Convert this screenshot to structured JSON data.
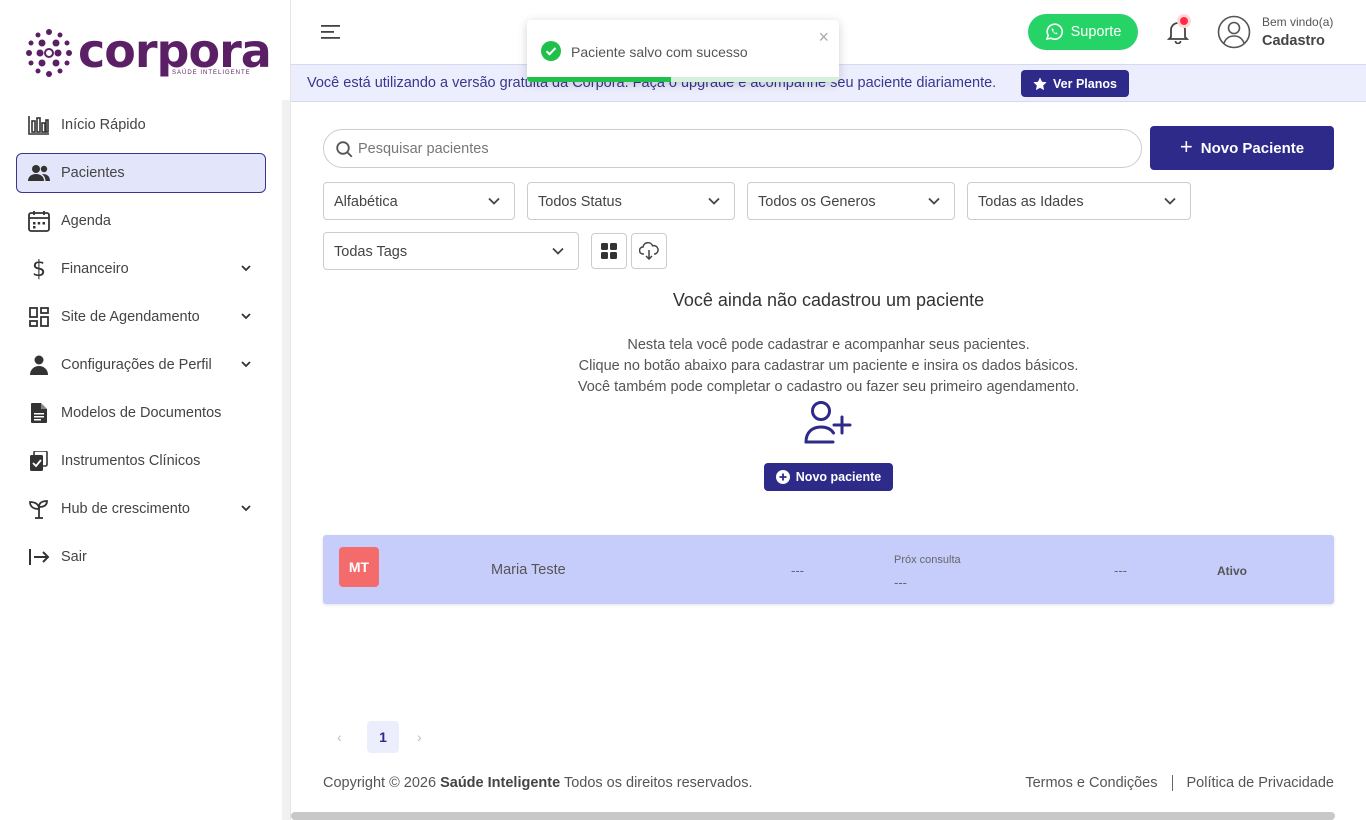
{
  "brand": {
    "name": "corpora",
    "tagline": "SAÚDE INTELIGENTE",
    "color": "#5b1f66"
  },
  "sidebar": {
    "items": [
      {
        "label": "Início Rápido",
        "icon": "bar-chart-icon"
      },
      {
        "label": "Pacientes",
        "icon": "users-icon",
        "active": true
      },
      {
        "label": "Agenda",
        "icon": "calendar-icon"
      },
      {
        "label": "Financeiro",
        "icon": "dollar-icon",
        "expandable": true
      },
      {
        "label": "Site de Agendamento",
        "icon": "dashboard-icon",
        "expandable": true
      },
      {
        "label": "Configurações de Perfil",
        "icon": "user-icon",
        "expandable": true
      },
      {
        "label": "Modelos de Documentos",
        "icon": "document-icon"
      },
      {
        "label": "Instrumentos Clínicos",
        "icon": "clipboard-check-icon"
      },
      {
        "label": "Hub de crescimento",
        "icon": "sprout-icon",
        "expandable": true
      },
      {
        "label": "Sair",
        "icon": "logout-icon"
      }
    ]
  },
  "header": {
    "support_label": "Suporte",
    "welcome": "Bem vindo(a)",
    "username": "Cadastro"
  },
  "banner": {
    "text": "Você está utilizando a versão gratuita da Corpora. Faça o upgrade e acompanhe seu paciente diariamente.",
    "button": "Ver Planos"
  },
  "toast": {
    "message": "Paciente salvo com sucesso",
    "close": "×",
    "progress": 0.46
  },
  "search": {
    "placeholder": "Pesquisar pacientes",
    "value": ""
  },
  "new_patient_button": "Novo Paciente",
  "filters": {
    "sort": "Alfabética",
    "status": "Todos Status",
    "gender": "Todos os Generos",
    "age": "Todas as Idades",
    "tags": "Todas Tags"
  },
  "empty_state": {
    "title": "Você ainda não cadastrou um paciente",
    "line1": "Nesta tela você pode cadastrar e acompanhar seus pacientes.",
    "line2": "Clique no botão abaixo para cadastrar um paciente e insira os dados básicos.",
    "line3": "Você também pode completar o cadastro ou fazer seu primeiro agendamento.",
    "button": "Novo paciente"
  },
  "patients": [
    {
      "initials": "MT",
      "name": "Maria Teste",
      "col1": "---",
      "next_label": "Próx consulta",
      "next_value": "---",
      "col3": "---",
      "status": "Ativo"
    }
  ],
  "pagination": {
    "prev": "‹",
    "current": "1",
    "next": "›"
  },
  "footer": {
    "copyright_prefix": "Copyright © 2026",
    "copyright_brand": "Saúde Inteligente",
    "copyright_suffix": "Todos os direitos reservados.",
    "terms": "Termos e Condições",
    "privacy": "Política de Privacidade"
  },
  "colors": {
    "primary": "#2d2a8a",
    "whatsapp": "#25d366",
    "row_bg": "#c6cdfb",
    "initials_bg": "#f36b6b",
    "success": "#20c14a"
  }
}
